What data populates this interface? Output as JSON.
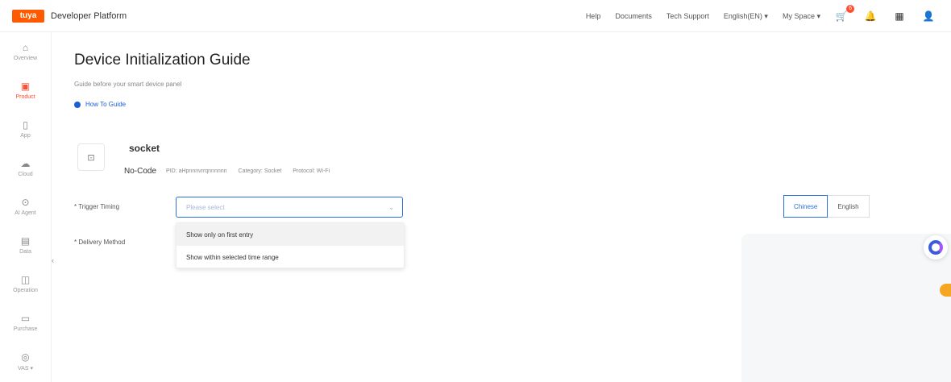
{
  "topbar": {
    "logo": "tuya",
    "brand": "Developer Platform",
    "links": [
      "Help",
      "Documents",
      "Tech Support",
      "English(EN) ▾",
      "My Space ▾"
    ],
    "cart_badge": "6"
  },
  "sidebar": {
    "items": [
      {
        "label": "Overview",
        "icon": "home-icon",
        "glyph": "⌂"
      },
      {
        "label": "Product",
        "icon": "product-icon",
        "glyph": "▣",
        "active": true
      },
      {
        "label": "App",
        "icon": "app-icon",
        "glyph": "▯"
      },
      {
        "label": "Cloud",
        "icon": "cloud-icon",
        "glyph": "☁"
      },
      {
        "label": "AI Agent",
        "icon": "ai-agent-icon",
        "glyph": "⊙"
      },
      {
        "label": "Data",
        "icon": "data-icon",
        "glyph": "▤"
      },
      {
        "label": "Operation",
        "icon": "operation-icon",
        "glyph": "◫"
      },
      {
        "label": "Purchase",
        "icon": "purchase-icon",
        "glyph": "▭"
      },
      {
        "label": "VAS ▾",
        "icon": "vas-icon",
        "glyph": "◎"
      }
    ]
  },
  "page": {
    "title": "Device Initialization Guide",
    "subtitle": "Guide before your smart device panel",
    "howto": "How To Guide"
  },
  "product": {
    "name": "socket",
    "nocode": "No-Code",
    "pid": "PID: aHpnnnvrrqnnnnnn",
    "category": "Category: Socket",
    "protocol": "Protocol: Wi-Fi"
  },
  "form": {
    "trigger_label": "* Trigger Timing",
    "trigger_placeholder": "Please select",
    "delivery_label": "* Delivery Method",
    "options": [
      "Show only on first entry",
      "Show within selected time range"
    ]
  },
  "language": {
    "options": [
      "Chinese",
      "English"
    ],
    "selected": "Chinese"
  },
  "colors": {
    "accent": "#2a6fdb",
    "brand": "#ff5a00"
  }
}
